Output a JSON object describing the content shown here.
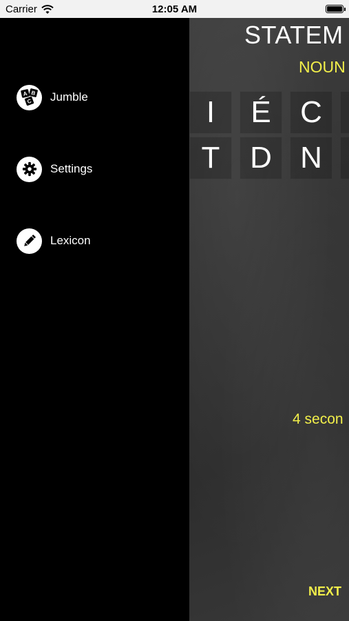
{
  "status_bar": {
    "carrier": "Carrier",
    "time": "12:05 AM"
  },
  "menu": {
    "items": [
      {
        "label": "Jumble",
        "icon": "abc-blocks-icon"
      },
      {
        "label": "Settings",
        "icon": "gear-icon"
      },
      {
        "label": "Lexicon",
        "icon": "pencil-icon"
      }
    ]
  },
  "game": {
    "title": "STATEM",
    "word_type": "NOUN",
    "tiles_row1": [
      "I",
      "É",
      "C"
    ],
    "tiles_row2": [
      "T",
      "D",
      "N"
    ],
    "timer": "4 secon",
    "next_label": "NEXT"
  },
  "colors": {
    "accent_yellow": "#f2ef4a",
    "menu_background": "#000000",
    "board_background": "#333333"
  }
}
